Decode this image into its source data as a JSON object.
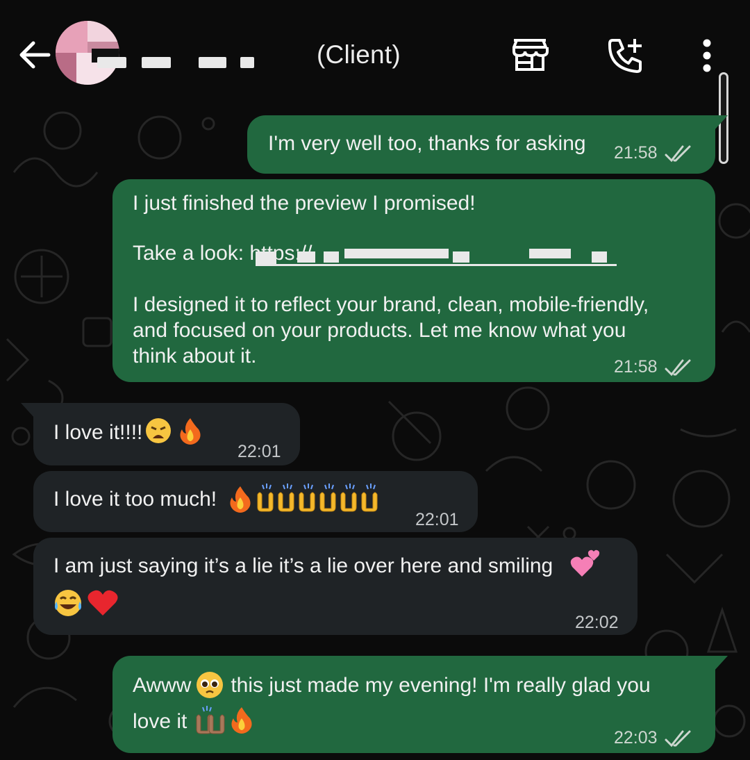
{
  "header": {
    "contact_tag": "(Client)",
    "icons": [
      "back-arrow-icon",
      "avatar",
      "store-icon",
      "add-call-icon",
      "more-vert-icon"
    ]
  },
  "colors": {
    "outgoing_bubble": "#21683f",
    "incoming_bubble": "#1f2326",
    "background": "#0b0b0b",
    "read_ticks": "#cdd7d0"
  },
  "messages": [
    {
      "direction": "outgoing",
      "lines": [
        "I'm very well too, thanks for asking"
      ],
      "time": "21:58",
      "status": "read"
    },
    {
      "direction": "outgoing",
      "lines": [
        "I just finished the preview I promised!",
        "Take a look: https://",
        "I designed it to reflect your brand, clean, mobile-friendly,",
        "and focused on your products. Let me know what you",
        "think about it."
      ],
      "time": "21:58",
      "status": "read"
    },
    {
      "direction": "incoming",
      "lines": [
        "I love it!!!!"
      ],
      "emojis": [
        "weary-face",
        "fire"
      ],
      "time": "22:01"
    },
    {
      "direction": "incoming",
      "lines": [
        "I love it too much!"
      ],
      "emojis": [
        "fire",
        "raising-hands",
        "raising-hands",
        "raising-hands",
        "raising-hands",
        "raising-hands",
        "raising-hands"
      ],
      "time": "22:01"
    },
    {
      "direction": "incoming",
      "lines": [
        "I am just saying it’s a lie it’s a lie over here and smiling"
      ],
      "emojis": [
        "two-hearts",
        "tears-of-joy",
        "red-heart"
      ],
      "time": "22:02"
    },
    {
      "direction": "outgoing",
      "lines": [
        "Awww",
        " this just made my evening! I'm really glad you",
        "love it"
      ],
      "emojis": [
        "pleading-face",
        "raising-hands",
        "fire"
      ],
      "time": "22:03",
      "status": "read"
    }
  ]
}
